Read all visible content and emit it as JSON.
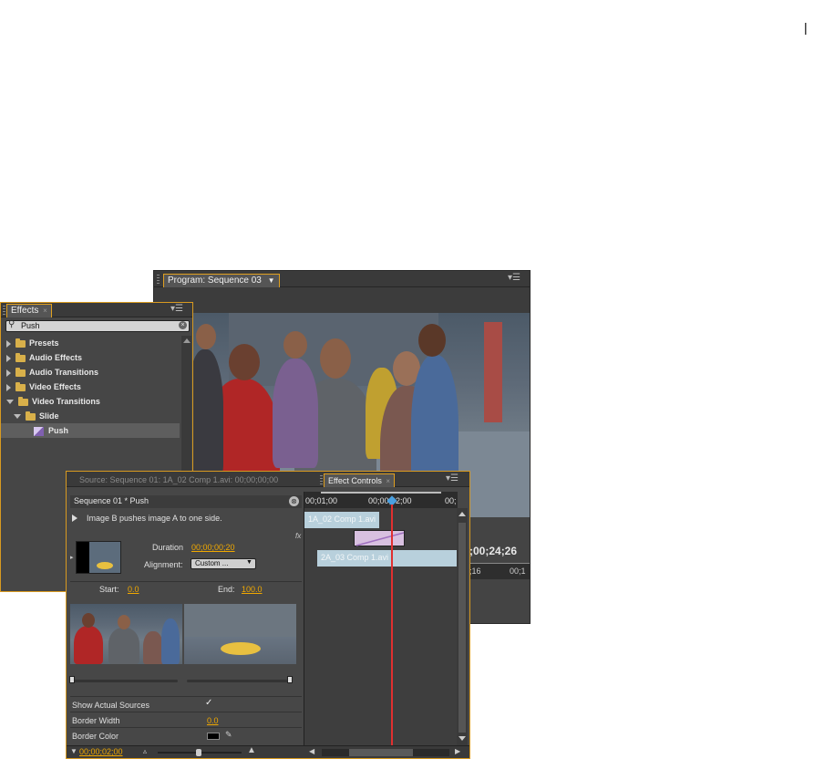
{
  "program_panel": {
    "tab_label": "Program: Sequence 03",
    "timecode_right": ";00;24;26",
    "ruler_a": ";16",
    "ruler_b": "00;1"
  },
  "effects_panel": {
    "tab_label": "Effects",
    "search_value": "Push",
    "items": [
      {
        "label": "Presets",
        "type": "preset-folder"
      },
      {
        "label": "Audio Effects",
        "type": "folder"
      },
      {
        "label": "Audio Transitions",
        "type": "folder"
      },
      {
        "label": "Video Effects",
        "type": "folder"
      },
      {
        "label": "Video Transitions",
        "type": "folder",
        "expanded": true
      },
      {
        "label": "Slide",
        "type": "folder",
        "expanded": true
      },
      {
        "label": "Push",
        "type": "effect",
        "selected": true
      }
    ]
  },
  "effect_controls": {
    "source_tab": "Source: Sequence 01: 1A_02 Comp 1.avi: 00;00;00;00",
    "active_tab": "Effect Controls",
    "header_title": "Sequence 01 * Push",
    "description": "Image B pushes image A to one side.",
    "duration_label": "Duration",
    "duration_value": "00;00;00;20",
    "alignment_label": "Alignment:",
    "alignment_value": "Custom ...",
    "start_label": "Start:",
    "start_value": "0.0",
    "end_label": "End:",
    "end_value": "100.0",
    "show_actual_sources_label": "Show Actual Sources",
    "show_actual_sources_checked": "✓",
    "border_width_label": "Border Width",
    "border_width_value": "0.0",
    "border_color_label": "Border Color",
    "bottom_timecode": "00;00;02;00",
    "timeline": {
      "time_left": "00;01;00",
      "time_mid": "00;00;02;00",
      "time_right": "00;",
      "clip_a": "1A_02 Comp 1.avi",
      "clip_b": "2A_03 Comp 1.avi",
      "fx_label": "fx"
    }
  },
  "colors": {
    "accent": "#e0a020",
    "playhead": "#e03030",
    "value": "#f0a800"
  },
  "page_marker": "|"
}
